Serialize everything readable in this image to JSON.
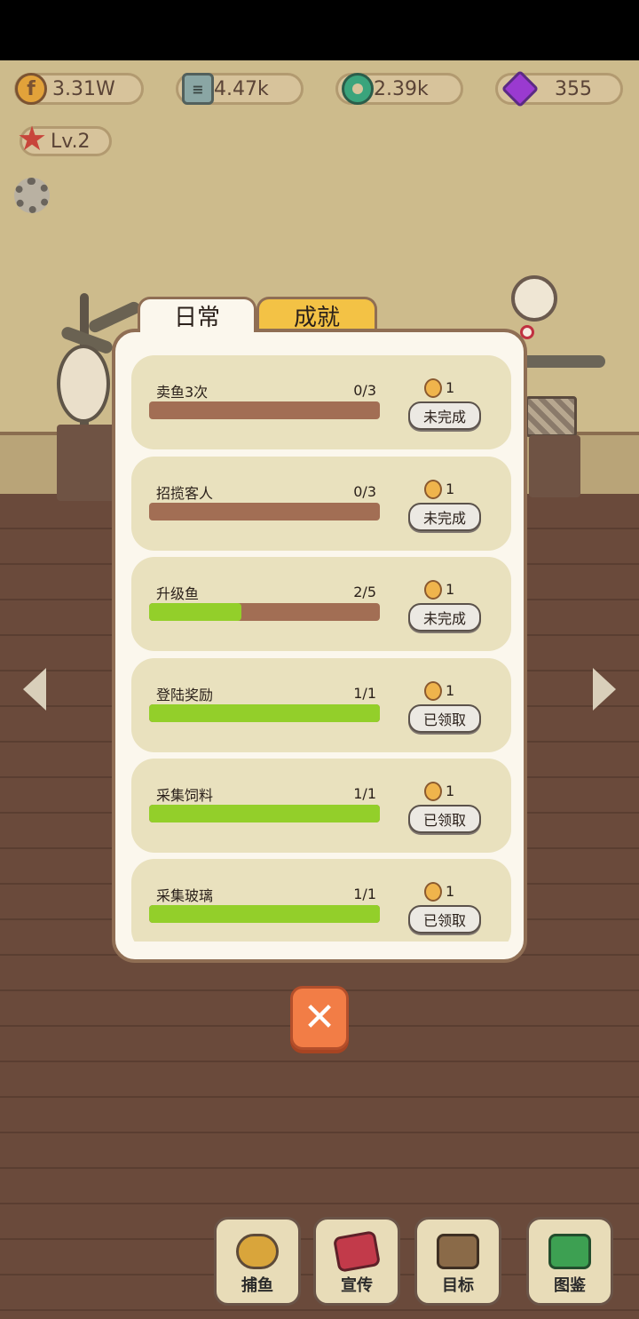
{
  "resources": {
    "coins": "3.31W",
    "books": "4.47k",
    "rings": "2.39k",
    "gems": "355"
  },
  "player": {
    "level": "Lv.2"
  },
  "panel": {
    "tabs": [
      {
        "label": "日常",
        "active": true
      },
      {
        "label": "成就",
        "active": false
      }
    ],
    "tasks": [
      {
        "name": "卖鱼3次",
        "progress": "0/3",
        "fraction": 0.0,
        "reward": "1",
        "button": "未完成"
      },
      {
        "name": "招揽客人",
        "progress": "0/3",
        "fraction": 0.0,
        "reward": "1",
        "button": "未完成"
      },
      {
        "name": "升级鱼",
        "progress": "2/5",
        "fraction": 0.4,
        "reward": "1",
        "button": "未完成"
      },
      {
        "name": "登陆奖励",
        "progress": "1/1",
        "fraction": 1.0,
        "reward": "1",
        "button": "已领取"
      },
      {
        "name": "采集饲料",
        "progress": "1/1",
        "fraction": 1.0,
        "reward": "1",
        "button": "已领取"
      },
      {
        "name": "采集玻璃",
        "progress": "1/1",
        "fraction": 1.0,
        "reward": "1",
        "button": "已领取"
      }
    ]
  },
  "close_label": "✕",
  "bottom_nav": [
    {
      "label": "捕鱼",
      "icon": "submarine-icon"
    },
    {
      "label": "宣传",
      "icon": "promo-icon"
    },
    {
      "label": "目标",
      "icon": "target-icon"
    },
    {
      "label": "图鉴",
      "icon": "fish-book-icon"
    }
  ],
  "colors": {
    "bar_empty": "#a26e54",
    "bar_fill": "#93cf2a",
    "tab_active": "#fbf7ed",
    "tab_inactive": "#f3c245",
    "close": "#f27d46"
  }
}
